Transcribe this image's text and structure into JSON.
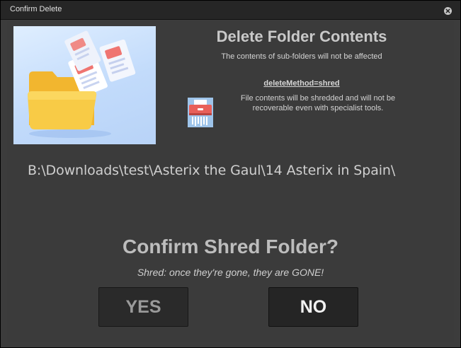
{
  "window": {
    "title": "Confirm Delete"
  },
  "header": {
    "title": "Delete Folder Contents",
    "subtitle": "The contents of sub-folders will not be affected"
  },
  "method": {
    "label": "deleteMethod=shred",
    "description": "File contents will be shredded and will not be recoverable even with specialist tools.",
    "icon": "shredder-icon"
  },
  "target": {
    "path": "B:\\Downloads\\test\\Asterix the Gaul\\14 Asterix in Spain\\"
  },
  "confirm": {
    "title": "Confirm Shred Folder?",
    "subtitle": "Shred: once they're gone, they are GONE!"
  },
  "buttons": {
    "yes": "YES",
    "no": "NO"
  },
  "colors": {
    "background": "#3b3b3b",
    "titlebar": "#262626",
    "button": "#2a2a2a",
    "folder": "#f7c53f",
    "accent_red": "#e8605a"
  }
}
